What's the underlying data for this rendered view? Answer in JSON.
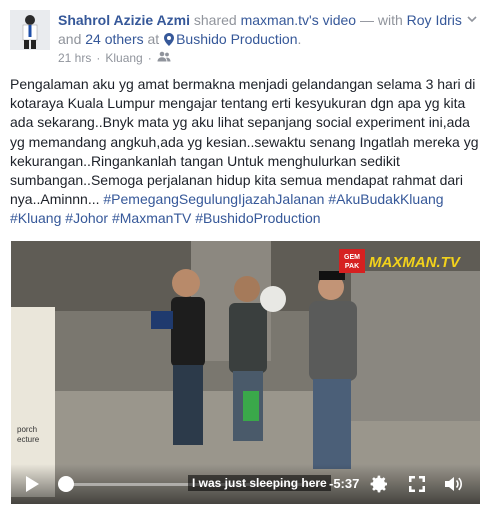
{
  "post": {
    "actor": "Shahrol Azizie Azmi",
    "shared_text": " shared ",
    "source_link": "maxman.tv's video",
    "with_text": " — with ",
    "tagged_person": "Roy Idris",
    "and_text": " and ",
    "others": "24 others",
    "at_text": " at ",
    "place": "Bushido Production",
    "end_text": ".",
    "time": "21 hrs",
    "dot": "·",
    "location": "Kluang",
    "dot2": "·",
    "body": "Pengalaman aku yg amat bermakna menjadi gelandangan selama 3 hari di kotaraya Kuala Lumpur mengajar tentang erti kesyukuran dgn apa yg kita ada sekarang..Bnyk mata yg aku lihat sepanjang social experiment ini,ada yg memandang angkuh,ada yg kesian..sewaktu senang Ingatlah mereka yg kekurangan..Ringankanlah tangan Untuk menghulurkan sedikit sumbangan..Semoga perjalanan hidup kita semua mendapat rahmat dari nya..Aminnn... ",
    "hashtags": [
      "#PemegangSegulungIjazahJalanan",
      "#AkuBudakKluang",
      "#Kluang",
      "#Johor",
      "#MaxmanTV",
      "#BushidoProduction"
    ]
  },
  "video": {
    "subtitle": "I was just sleeping here",
    "time_remaining": "-5:37",
    "progress": 0.02,
    "sign_text": "porch\necture",
    "logo_badge": "GEM\nPAK",
    "logo_text": "MAXMAN.TV"
  },
  "icons": {
    "chevron": "chevron-down-icon",
    "pin": "map-pin-icon",
    "audience": "friends-audience-icon",
    "play": "play-icon",
    "settings": "gear-icon",
    "fullscreen": "fullscreen-icon",
    "volume": "volume-icon"
  },
  "colors": {
    "link": "#365899",
    "text": "#1d2129",
    "meta": "#90949c"
  }
}
